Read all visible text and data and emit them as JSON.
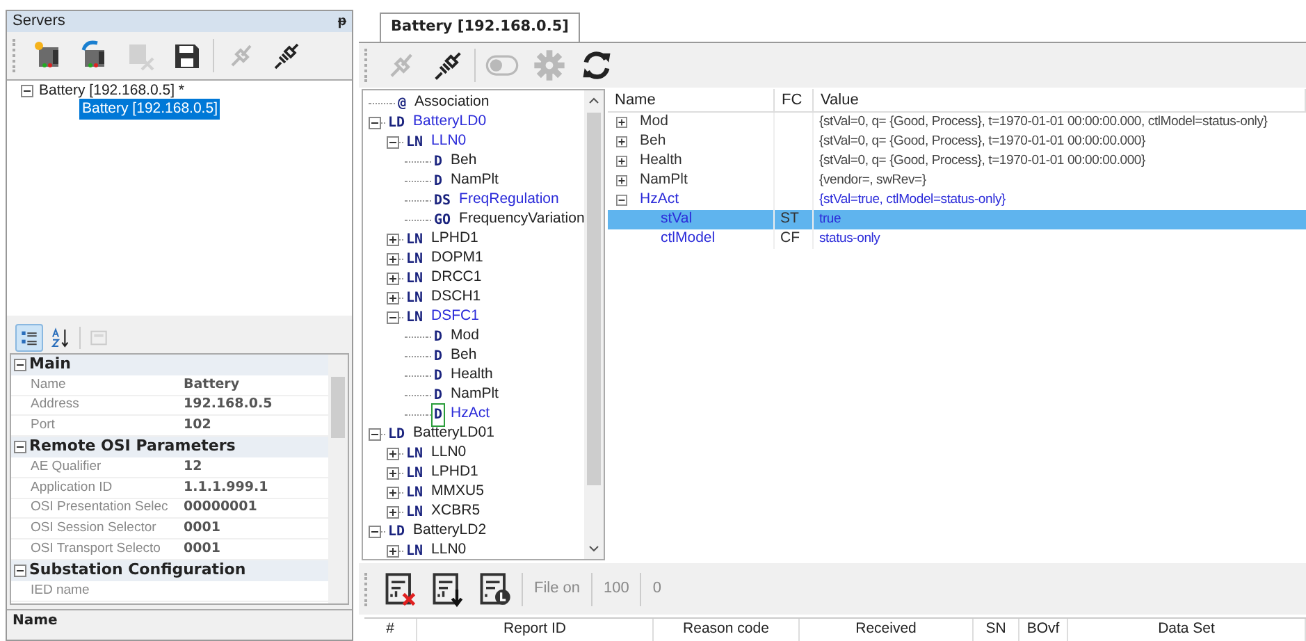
{
  "servers_panel": {
    "title": "Servers",
    "pin": "ᵽ",
    "toolbar": [
      {
        "kind": "new-server",
        "disabled": false
      },
      {
        "kind": "reload-server",
        "disabled": false
      },
      {
        "kind": "remove-server",
        "disabled": true
      },
      {
        "kind": "save",
        "disabled": false
      },
      {
        "kind": "connect",
        "disabled": true
      },
      {
        "kind": "disconnect",
        "disabled": false
      }
    ],
    "tree": [
      {
        "label": "Battery [192.168.0.5] *",
        "expanded": true,
        "selected": false,
        "children": [
          {
            "label": "Battery [192.168.0.5]",
            "selected": true
          }
        ]
      }
    ]
  },
  "properties": {
    "toolbar": [
      {
        "kind": "categorized",
        "selected": true,
        "disabled": false
      },
      {
        "kind": "sort-az",
        "selected": false,
        "disabled": false
      },
      {
        "kind": "pages",
        "selected": false,
        "disabled": true
      }
    ],
    "categories": [
      {
        "name": "Main",
        "expanded": true,
        "rows": [
          {
            "name": "Name",
            "value": "Battery"
          },
          {
            "name": "Address",
            "value": "192.168.0.5"
          },
          {
            "name": "Port",
            "value": "102"
          }
        ]
      },
      {
        "name": "Remote OSI Parameters",
        "expanded": true,
        "rows": [
          {
            "name": "AE Qualifier",
            "value": "12"
          },
          {
            "name": "Application ID",
            "value": "1.1.1.999.1"
          },
          {
            "name": "OSI Presentation Selec",
            "value": "00000001"
          },
          {
            "name": "OSI Session Selector",
            "value": "0001"
          },
          {
            "name": "OSI Transport Selecto",
            "value": "0001"
          }
        ]
      },
      {
        "name": "Substation Configuration",
        "expanded": true,
        "rows": [
          {
            "name": "IED name",
            "value": ""
          }
        ]
      }
    ],
    "description_title": "Name"
  },
  "document": {
    "tab": {
      "label": "Battery [192.168.0.5]",
      "selected": true
    },
    "toolbar": [
      {
        "kind": "connect",
        "disabled": true
      },
      {
        "kind": "disconnect",
        "disabled": false
      },
      {
        "kind": "toggle",
        "disabled": true
      },
      {
        "kind": "gear",
        "disabled": true
      },
      {
        "kind": "refresh",
        "disabled": false
      }
    ],
    "model_tree": [
      {
        "tag": "@",
        "label": "Association",
        "highlighted": false,
        "selected": false
      },
      {
        "tag": "LD",
        "label": "BatteryLD0",
        "highlighted": true,
        "selected": false,
        "expanded": true,
        "children": [
          {
            "tag": "LN",
            "label": "LLN0",
            "highlighted": true,
            "selected": false,
            "expanded": true,
            "children": [
              {
                "tag": "D",
                "label": "Beh",
                "highlighted": false,
                "selected": false
              },
              {
                "tag": "D",
                "label": "NamPlt",
                "highlighted": false,
                "selected": false
              },
              {
                "tag": "DS",
                "label": "FreqRegulation",
                "highlighted": true,
                "selected": false
              },
              {
                "tag": "GO",
                "label": "FrequencyVariation",
                "highlighted": false,
                "selected": false
              }
            ]
          },
          {
            "tag": "LN",
            "label": "LPHD1",
            "highlighted": false,
            "selected": false,
            "expanded": false
          },
          {
            "tag": "LN",
            "label": "DOPM1",
            "highlighted": false,
            "selected": false,
            "expanded": false
          },
          {
            "tag": "LN",
            "label": "DRCC1",
            "highlighted": false,
            "selected": false,
            "expanded": false
          },
          {
            "tag": "LN",
            "label": "DSCH1",
            "highlighted": false,
            "selected": false,
            "expanded": false
          },
          {
            "tag": "LN",
            "label": "DSFC1",
            "highlighted": true,
            "selected": false,
            "expanded": true,
            "children": [
              {
                "tag": "D",
                "label": "Mod",
                "highlighted": false,
                "selected": false
              },
              {
                "tag": "D",
                "label": "Beh",
                "highlighted": false,
                "selected": false
              },
              {
                "tag": "D",
                "label": "Health",
                "highlighted": false,
                "selected": false
              },
              {
                "tag": "D",
                "label": "NamPlt",
                "highlighted": false,
                "selected": false
              },
              {
                "tag": "D",
                "label": "HzAct",
                "highlighted": true,
                "selected": true
              }
            ]
          }
        ]
      },
      {
        "tag": "LD",
        "label": "BatteryLD01",
        "highlighted": false,
        "selected": false,
        "expanded": true,
        "children": [
          {
            "tag": "LN",
            "label": "LLN0",
            "highlighted": false,
            "selected": false,
            "expanded": false
          },
          {
            "tag": "LN",
            "label": "LPHD1",
            "highlighted": false,
            "selected": false,
            "expanded": false
          },
          {
            "tag": "LN",
            "label": "MMXU5",
            "highlighted": false,
            "selected": false,
            "expanded": false
          },
          {
            "tag": "LN",
            "label": "XCBR5",
            "highlighted": false,
            "selected": false,
            "expanded": false
          }
        ]
      },
      {
        "tag": "LD",
        "label": "BatteryLD2",
        "highlighted": false,
        "selected": false,
        "expanded": true,
        "children": [
          {
            "tag": "LN",
            "label": "LLN0",
            "highlighted": false,
            "selected": false,
            "expanded": false
          }
        ]
      }
    ],
    "table": {
      "columns": [
        "Name",
        "FC",
        "Value"
      ],
      "rows": [
        {
          "name": "Mod",
          "fc": "",
          "value": "{stVal=0, q= {Good, Process}, t=1970-01-01 00:00:00.000, ctlModel=status-only}",
          "expanded": false,
          "highlighted": false,
          "selected": false
        },
        {
          "name": "Beh",
          "fc": "",
          "value": "{stVal=0, q= {Good, Process}, t=1970-01-01 00:00:00.000}",
          "expanded": false,
          "highlighted": false,
          "selected": false
        },
        {
          "name": "Health",
          "fc": "",
          "value": "{stVal=0, q= {Good, Process}, t=1970-01-01 00:00:00.000}",
          "expanded": false,
          "highlighted": false,
          "selected": false
        },
        {
          "name": "NamPlt",
          "fc": "",
          "value": "{vendor=, swRev=}",
          "expanded": false,
          "highlighted": false,
          "selected": false
        },
        {
          "name": "HzAct",
          "fc": "",
          "value": "{stVal=true, ctlModel=status-only}",
          "expanded": true,
          "highlighted": true,
          "selected": false,
          "children": [
            {
              "name": "stVal",
              "fc": "ST",
              "value": "true",
              "highlighted": true,
              "selected": true
            },
            {
              "name": "ctlModel",
              "fc": "CF",
              "value": "status-only",
              "highlighted": true,
              "selected": false
            }
          ]
        }
      ]
    },
    "reports": {
      "toolbar": [
        {
          "kind": "report-delete",
          "disabled": false
        },
        {
          "kind": "report-download",
          "disabled": false
        },
        {
          "kind": "report-log",
          "disabled": false
        }
      ],
      "file_label": "File on",
      "counts": [
        "100",
        "0"
      ],
      "columns": [
        "#",
        "Report ID",
        "Reason code",
        "Received",
        "SN",
        "BOvf",
        "Data Set"
      ]
    }
  }
}
